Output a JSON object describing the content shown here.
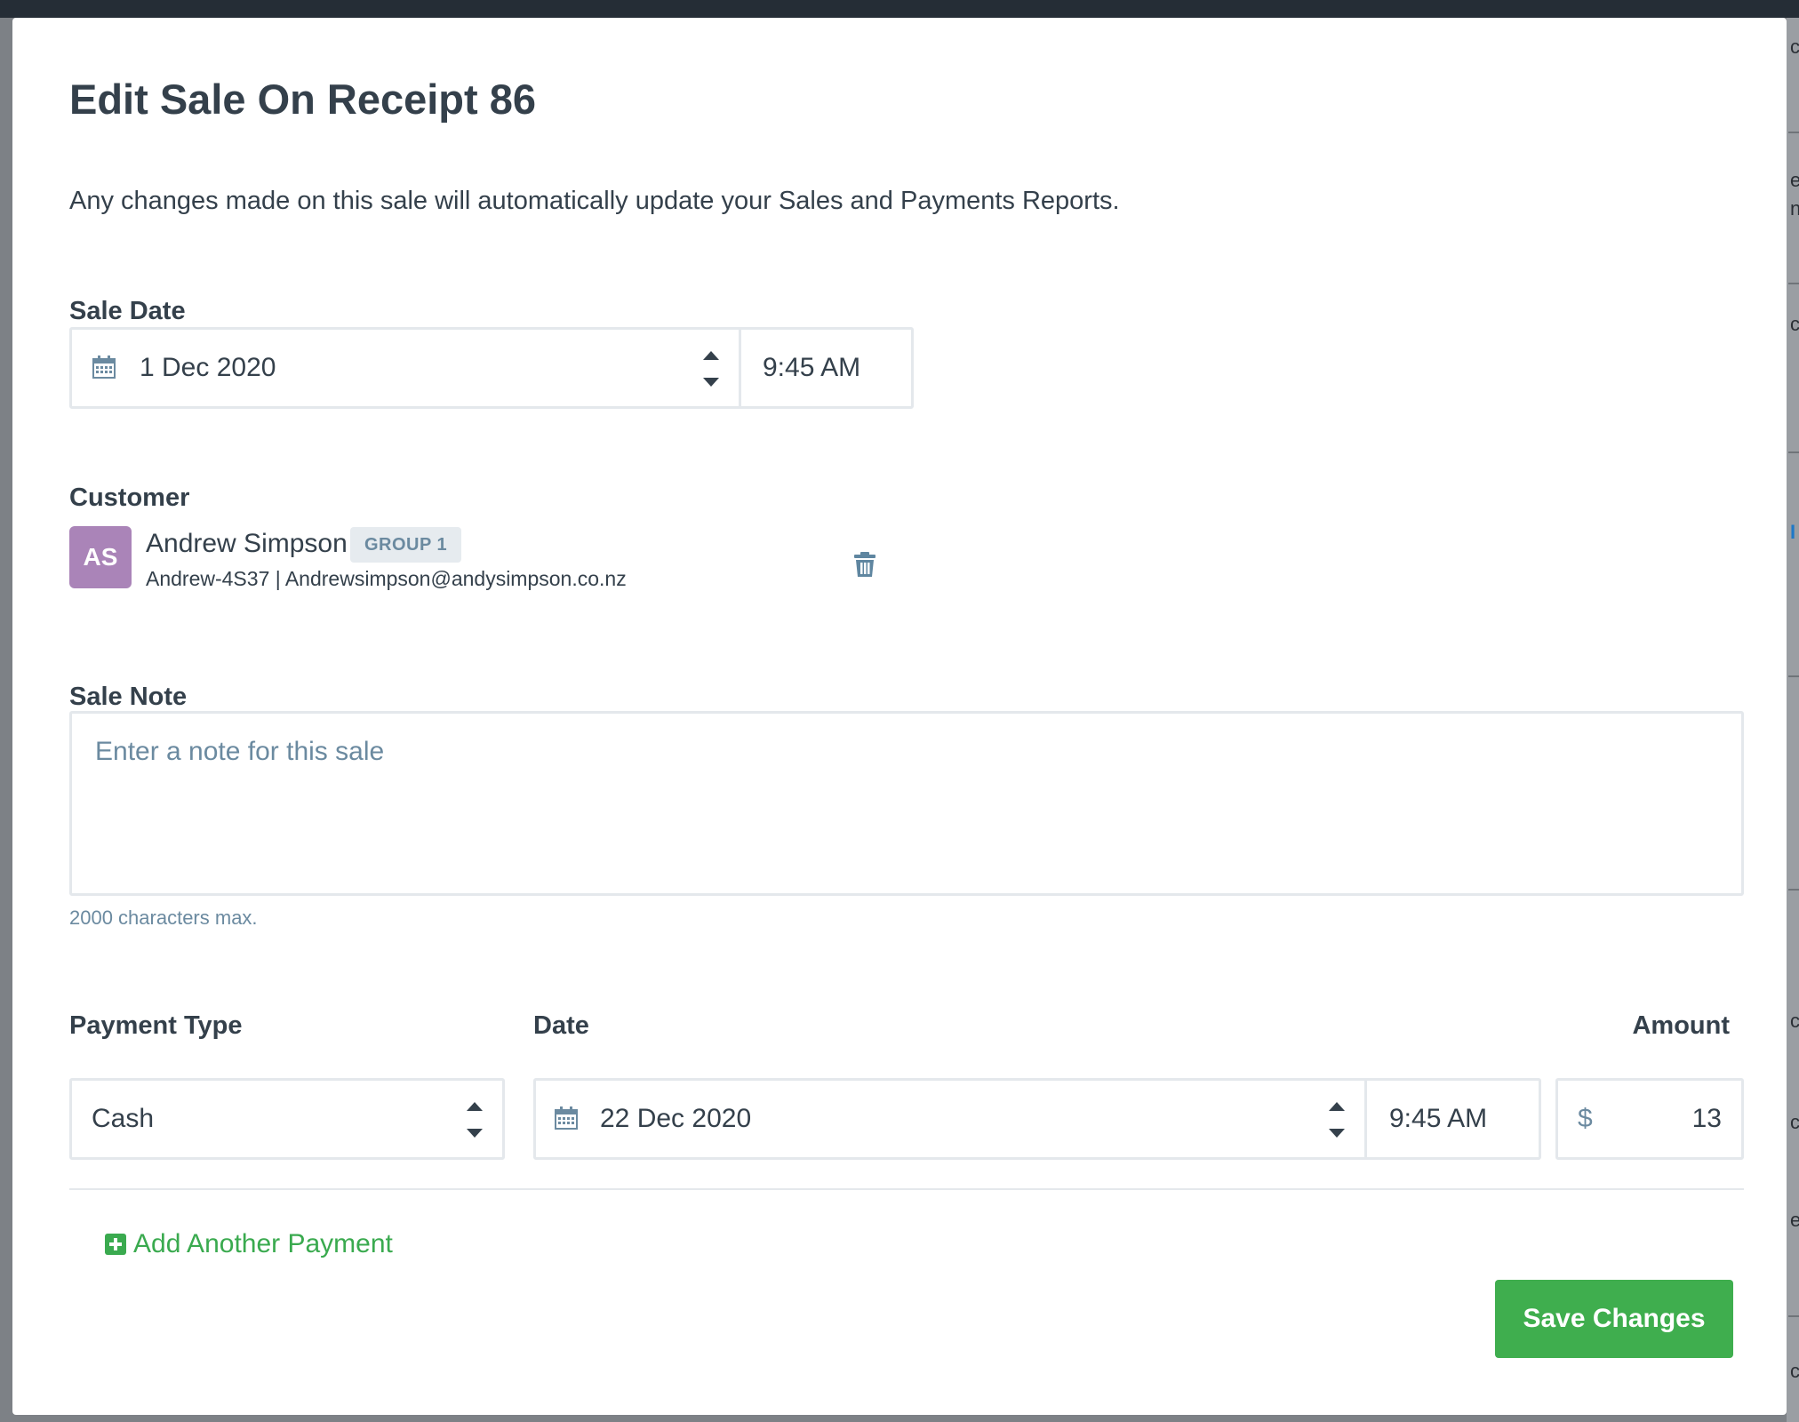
{
  "modal": {
    "title": "Edit Sale On Receipt 86",
    "subtitle": "Any changes made on this sale will automatically update your Sales and Payments Reports."
  },
  "sale_date": {
    "label": "Sale Date",
    "date": "1 Dec 2020",
    "time": "9:45 AM"
  },
  "customer": {
    "label": "Customer",
    "initials": "AS",
    "name": "Andrew Simpson",
    "group": "GROUP 1",
    "meta": "Andrew-4S37 | Andrewsimpson@andysimpson.co.nz",
    "avatar_color": "#aa84b8"
  },
  "sale_note": {
    "label": "Sale Note",
    "placeholder": "Enter a note for this sale",
    "hint": "2000 characters max."
  },
  "payment": {
    "type_label": "Payment Type",
    "date_label": "Date",
    "amount_label": "Amount",
    "type": "Cash",
    "date": "22 Dec 2020",
    "time": "9:45 AM",
    "currency_symbol": "$",
    "amount": "13"
  },
  "actions": {
    "add_payment": "Add Another Payment",
    "save": "Save Changes"
  },
  "colors": {
    "primary_green": "#3fae4e",
    "text": "#34404b",
    "muted_blue": "#6b8aa0",
    "border": "#e4e8ec"
  },
  "icons": {
    "calendar": "calendar-icon",
    "trash": "trash-icon",
    "spinner": "spinner-arrows-icon",
    "plus": "plus-square-icon"
  }
}
